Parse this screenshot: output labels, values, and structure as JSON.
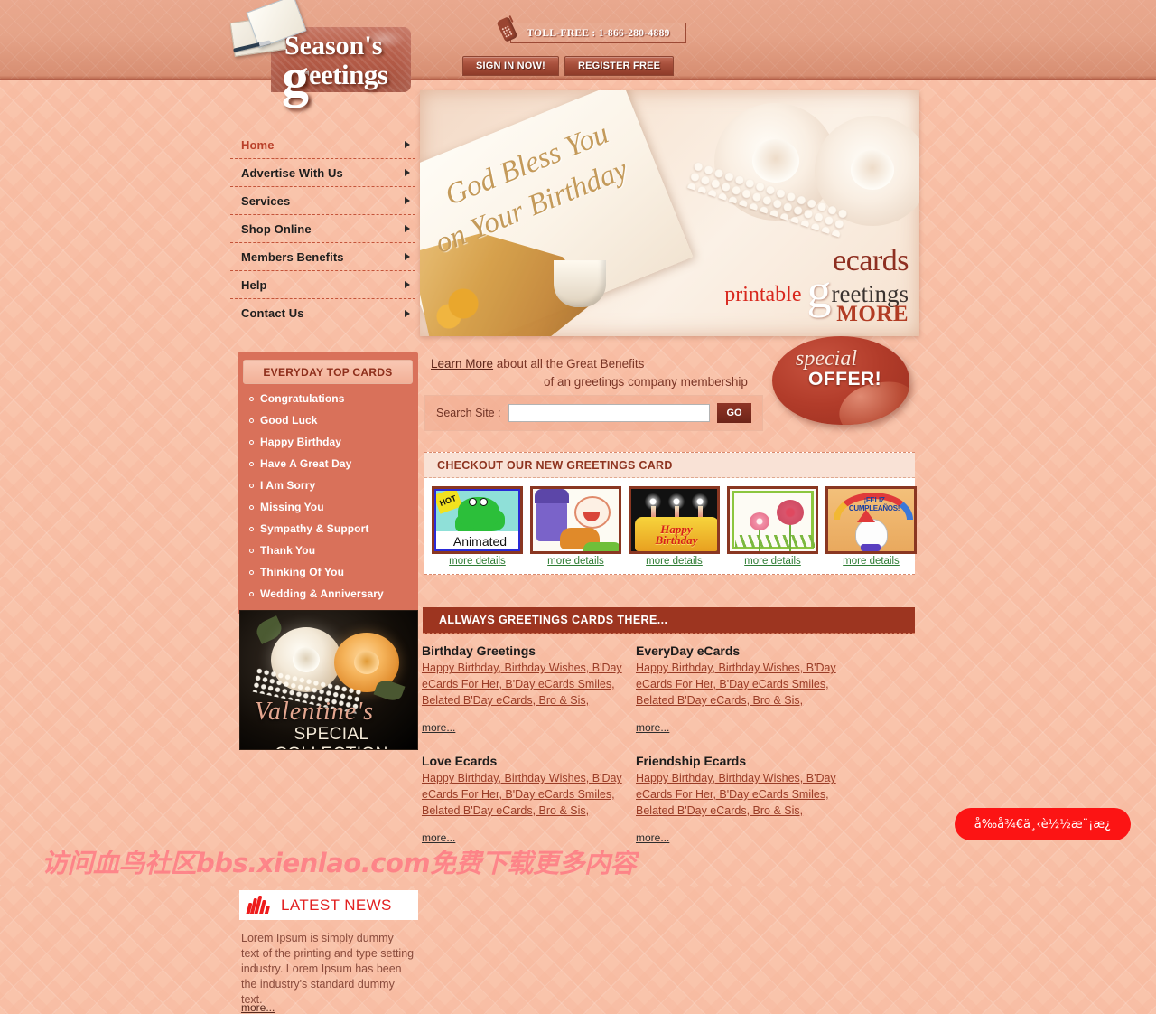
{
  "header": {
    "logo_line1": "Season's",
    "logo_line2": "reetings",
    "logo_g": "g",
    "tollfree": "TOLL-FREE : 1-866-280-4889",
    "buttons": [
      {
        "label": "SIGN IN NOW!"
      },
      {
        "label": "REGISTER FREE"
      }
    ]
  },
  "sidebar": {
    "nav": [
      {
        "label": "Home",
        "active": true
      },
      {
        "label": "Advertise With Us",
        "active": false
      },
      {
        "label": "Services",
        "active": false
      },
      {
        "label": "Shop Online",
        "active": false
      },
      {
        "label": "Members Benefits",
        "active": false
      },
      {
        "label": "Help",
        "active": false
      },
      {
        "label": "Contact Us",
        "active": false
      }
    ],
    "topcards": {
      "title": "EVERYDAY TOP CARDS",
      "items": [
        "Congratulations",
        "Good Luck",
        "Happy Birthday",
        "Have A Great Day",
        "I Am Sorry",
        "Missing You",
        "Sympathy & Support",
        "Thank You",
        "Thinking Of You",
        "Wedding & Anniversary"
      ]
    },
    "valentine": {
      "script": "Valentine's",
      "subtitle": "SPECIAL COLLECTION"
    },
    "news": {
      "title": "LATEST NEWS",
      "body": "Lorem Ipsum is simply dummy text of the printing and type setting industry. Lorem Ipsum has been the industry's standard dummy text.",
      "more": "more..."
    }
  },
  "banner": {
    "script_line1": "God Bless You",
    "script_line2": "on Your Birthday",
    "ecards": "ecards",
    "printable": "printable",
    "g": "g",
    "greetings": "reetings",
    "more": "MORE"
  },
  "offer": {
    "special": "special",
    "offer": "OFFER!"
  },
  "learn": {
    "link": "Learn More",
    "text1": " about all the Great Benefits",
    "text2": "of an greetings company membership"
  },
  "search": {
    "label": "Search Site :",
    "value": "",
    "placeholder": "",
    "go_label": "GO"
  },
  "checkout": {
    "title": "CHECKOUT OUR NEW GREETINGS CARD",
    "cards": [
      {
        "art": "frog-animated",
        "hot": "HOT",
        "caption": "Animated",
        "more": "more details"
      },
      {
        "art": "clown-dog",
        "more": "more details"
      },
      {
        "art": "birthday-cake",
        "caption": "Happy Birthday",
        "more": "more details"
      },
      {
        "art": "flowers",
        "more": "more details"
      },
      {
        "art": "feliz-cumpleanos",
        "caption": "¡FELIZ CUMPLEAÑOS!",
        "more": "more details"
      }
    ]
  },
  "allways": {
    "title": "ALLWAYS GREETINGS CARDS THERE...",
    "sections": [
      {
        "title": "Birthday Greetings",
        "links": "Happy Birthday, Birthday Wishes, B'Day eCards For Her, B'Day eCards Smiles, Belated B'Day eCards, Bro & Sis,",
        "more": "more..."
      },
      {
        "title": "EveryDay eCards",
        "links": "Happy Birthday, Birthday Wishes, B'Day eCards For Her, B'Day eCards Smiles, Belated B'Day eCards, Bro & Sis,",
        "more": "more..."
      },
      {
        "title": "Love Ecards",
        "links": "Happy Birthday, Birthday Wishes, B'Day eCards For Her, B'Day eCards Smiles, Belated B'Day eCards, Bro & Sis,",
        "more": "more..."
      },
      {
        "title": "Friendship Ecards",
        "links": "Happy Birthday, Birthday Wishes, B'Day eCards For Her, B'Day eCards Smiles, Belated B'Day eCards, Bro & Sis,",
        "more": "more..."
      }
    ]
  },
  "overlay": {
    "watermark": "访问血鸟社区bbs.xienlao.com免费下载更多内容",
    "red_button": "å‰å¾€ä¸‹è½½æ¨¡æ¿"
  },
  "colors": {
    "page_bg": "#f9c4ab",
    "header_band": "#e09a7e",
    "accent_dark_red": "#9d3520",
    "accent_red": "#b9402a",
    "topcards_bg": "#d9715a",
    "link_green": "#2f7d35",
    "watermark_pink": "#ff6e7d",
    "red_button": "#fc1414"
  }
}
